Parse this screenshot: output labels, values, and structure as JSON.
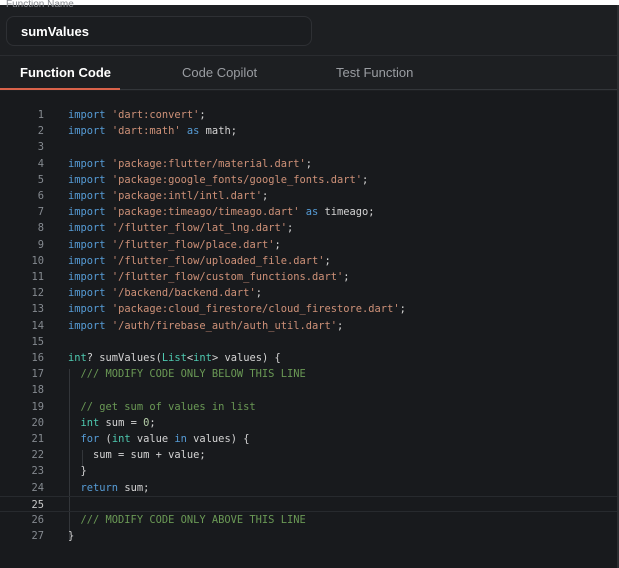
{
  "function_name": {
    "label": "Function Name",
    "value": "sumValues"
  },
  "tabs": [
    {
      "label": "Function Code",
      "active": true
    },
    {
      "label": "Code Copilot"
    },
    {
      "label": "Test Function"
    }
  ],
  "colors": {
    "accent": "#d9624a",
    "keyword": "#569cd6",
    "string": "#ce9178",
    "type": "#4ec9b0",
    "comment": "#6a9955",
    "number": "#b5cea8"
  },
  "editor": {
    "current_line": 25,
    "lines": [
      [
        [
          "k",
          "import"
        ],
        [
          "p",
          " "
        ],
        [
          "s",
          "'dart:convert'"
        ],
        [
          "p",
          ";"
        ]
      ],
      [
        [
          "k",
          "import"
        ],
        [
          "p",
          " "
        ],
        [
          "s",
          "'dart:math'"
        ],
        [
          "p",
          " "
        ],
        [
          "k",
          "as"
        ],
        [
          "p",
          " math;"
        ]
      ],
      [],
      [
        [
          "k",
          "import"
        ],
        [
          "p",
          " "
        ],
        [
          "s",
          "'package:flutter/material.dart'"
        ],
        [
          "p",
          ";"
        ]
      ],
      [
        [
          "k",
          "import"
        ],
        [
          "p",
          " "
        ],
        [
          "s",
          "'package:google_fonts/google_fonts.dart'"
        ],
        [
          "p",
          ";"
        ]
      ],
      [
        [
          "k",
          "import"
        ],
        [
          "p",
          " "
        ],
        [
          "s",
          "'package:intl/intl.dart'"
        ],
        [
          "p",
          ";"
        ]
      ],
      [
        [
          "k",
          "import"
        ],
        [
          "p",
          " "
        ],
        [
          "s",
          "'package:timeago/timeago.dart'"
        ],
        [
          "p",
          " "
        ],
        [
          "k",
          "as"
        ],
        [
          "p",
          " timeago;"
        ]
      ],
      [
        [
          "k",
          "import"
        ],
        [
          "p",
          " "
        ],
        [
          "s",
          "'/flutter_flow/lat_lng.dart'"
        ],
        [
          "p",
          ";"
        ]
      ],
      [
        [
          "k",
          "import"
        ],
        [
          "p",
          " "
        ],
        [
          "s",
          "'/flutter_flow/place.dart'"
        ],
        [
          "p",
          ";"
        ]
      ],
      [
        [
          "k",
          "import"
        ],
        [
          "p",
          " "
        ],
        [
          "s",
          "'/flutter_flow/uploaded_file.dart'"
        ],
        [
          "p",
          ";"
        ]
      ],
      [
        [
          "k",
          "import"
        ],
        [
          "p",
          " "
        ],
        [
          "s",
          "'/flutter_flow/custom_functions.dart'"
        ],
        [
          "p",
          ";"
        ]
      ],
      [
        [
          "k",
          "import"
        ],
        [
          "p",
          " "
        ],
        [
          "s",
          "'/backend/backend.dart'"
        ],
        [
          "p",
          ";"
        ]
      ],
      [
        [
          "k",
          "import"
        ],
        [
          "p",
          " "
        ],
        [
          "s",
          "'package:cloud_firestore/cloud_firestore.dart'"
        ],
        [
          "p",
          ";"
        ]
      ],
      [
        [
          "k",
          "import"
        ],
        [
          "p",
          " "
        ],
        [
          "s",
          "'/auth/firebase_auth/auth_util.dart'"
        ],
        [
          "p",
          ";"
        ]
      ],
      [],
      [
        [
          "t",
          "int"
        ],
        [
          "p",
          "? sumValues("
        ],
        [
          "t",
          "List"
        ],
        [
          "p",
          "<"
        ],
        [
          "t",
          "int"
        ],
        [
          "p",
          "> values) {"
        ]
      ],
      [
        [
          "p",
          "  "
        ],
        [
          "c",
          "/// MODIFY CODE ONLY BELOW THIS LINE"
        ]
      ],
      [],
      [
        [
          "p",
          "  "
        ],
        [
          "c",
          "// get sum of values in list"
        ]
      ],
      [
        [
          "p",
          "  "
        ],
        [
          "t",
          "int"
        ],
        [
          "p",
          " sum = "
        ],
        [
          "n",
          "0"
        ],
        [
          "p",
          ";"
        ]
      ],
      [
        [
          "p",
          "  "
        ],
        [
          "k",
          "for"
        ],
        [
          "p",
          " ("
        ],
        [
          "t",
          "int"
        ],
        [
          "p",
          " value "
        ],
        [
          "k",
          "in"
        ],
        [
          "p",
          " values) {"
        ]
      ],
      [
        [
          "p",
          "    sum = sum + value;"
        ]
      ],
      [
        [
          "p",
          "  }"
        ]
      ],
      [
        [
          "p",
          "  "
        ],
        [
          "k",
          "return"
        ],
        [
          "p",
          " sum;"
        ]
      ],
      [],
      [
        [
          "p",
          "  "
        ],
        [
          "c",
          "/// MODIFY CODE ONLY ABOVE THIS LINE"
        ]
      ],
      [
        [
          "p",
          "}"
        ]
      ]
    ]
  }
}
